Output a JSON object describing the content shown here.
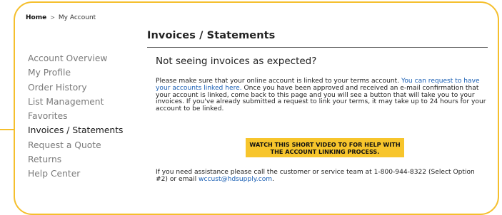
{
  "breadcrumb": {
    "home": "Home",
    "separator": ">",
    "current": "My Account"
  },
  "page": {
    "title": "Invoices / Statements"
  },
  "sidebar": {
    "items": [
      {
        "label": "Account Overview"
      },
      {
        "label": "My Profile"
      },
      {
        "label": "Order History"
      },
      {
        "label": "List Management"
      },
      {
        "label": "Favorites"
      },
      {
        "label": "Invoices / Statements"
      },
      {
        "label": "Request a Quote"
      },
      {
        "label": "Returns"
      },
      {
        "label": "Help Center"
      }
    ]
  },
  "main": {
    "heading": "Not seeing invoices as expected?",
    "para1_before": "Please make sure that your online account is linked to your terms account. ",
    "para1_link": "You can request to have your accounts linked here.",
    "para1_after": " Once you have been approved and received an e-mail confirmation that your account is linked, come back to this page and you will see a button that will take you to your invoices. If you've already submitted a request to link your terms, it may take up to 24 hours for your account to be linked.",
    "video_button": "WATCH THIS SHORT VIDEO TO FOR HELP WITH THE ACCOUNT LINKING PROCESS.",
    "para2_before": "If you need assistance please call the customer or service team at 1-800-944-8322 (Select Option #2) or email ",
    "para2_email": "wccust@hdsupply.com",
    "para2_after": "."
  },
  "colors": {
    "accent_yellow": "#f7c52c",
    "frame_yellow": "#f5bf2d",
    "link_blue": "#1a5fb4",
    "sidebar_inactive": "#7a7a7a"
  }
}
